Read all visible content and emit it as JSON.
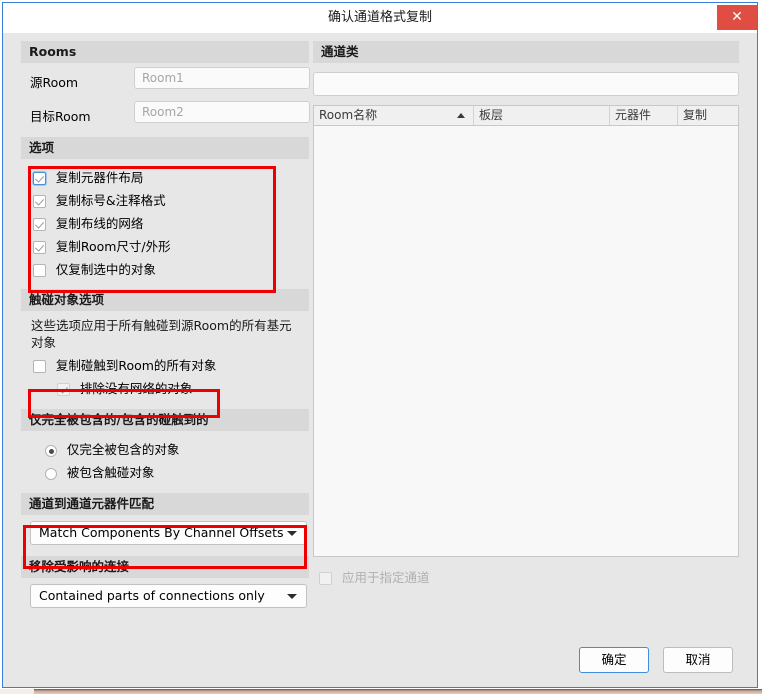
{
  "window": {
    "title": "确认通道格式复制",
    "close_label": "✕"
  },
  "rooms": {
    "header": "Rooms",
    "source_label": "源Room",
    "source_value": "Room1",
    "target_label": "目标Room",
    "target_value": "Room2"
  },
  "options": {
    "header": "选项",
    "items": [
      {
        "label": "复制元器件布局",
        "checked": true,
        "focused": true
      },
      {
        "label": "复制标号&注释格式",
        "checked": true,
        "focused": false
      },
      {
        "label": "复制布线的网络",
        "checked": true,
        "focused": false
      },
      {
        "label": "复制Room尺寸/外形",
        "checked": true,
        "focused": false
      },
      {
        "label": "仅复制选中的对象",
        "checked": false,
        "focused": false
      }
    ]
  },
  "touch_options": {
    "header": "触碰对象选项",
    "description": "这些选项应用于所有触碰到源Room的所有基元对象",
    "copy_touching_label": "复制碰触到Room的所有对象",
    "copy_touching_checked": false,
    "exclude_no_net_label": "排除没有网络的对象",
    "exclude_no_net_checked": true
  },
  "containment": {
    "header": "仅完全被包含的/包含的碰触到的",
    "options": [
      {
        "label": "仅完全被包含的对象",
        "selected": true
      },
      {
        "label": "被包含触碰对象",
        "selected": false
      }
    ]
  },
  "channel_match": {
    "header": "通道到通道元器件匹配",
    "selected": "Match Components By Channel Offsets"
  },
  "remove_connections": {
    "header": "移除受影响的连接",
    "selected": "Contained parts of connections only"
  },
  "channel_class": {
    "header": "通道类",
    "search_value": "",
    "search_placeholder": "",
    "columns": [
      "Room名称",
      "板层",
      "元器件",
      "复制"
    ],
    "rows": [],
    "apply_label": "应用于指定通道",
    "apply_checked": false
  },
  "footer": {
    "ok_label": "确定",
    "cancel_label": "取消"
  },
  "colors": {
    "accent": "#3a7fd5",
    "close_red": "#e04d42",
    "annotation_red": "#ee0000",
    "section_header_bg": "#d8d8d8"
  }
}
